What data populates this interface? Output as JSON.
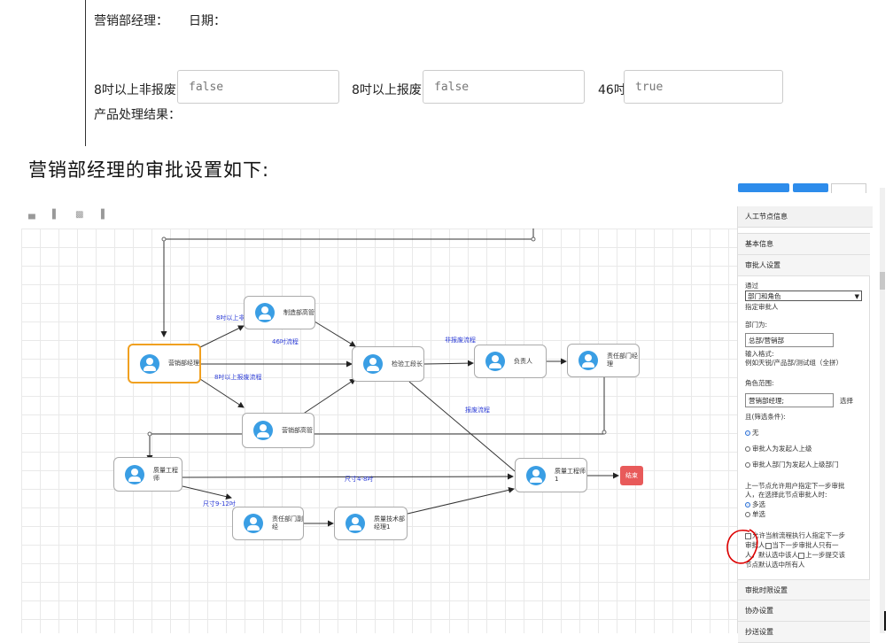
{
  "form": {
    "line1": "营销部经理：",
    "date_label": "日期：",
    "field1_label": "8吋以上非报废",
    "field1_value": "false",
    "field2_label": "8吋以上报废",
    "field2_value": "false",
    "field3_label": "46吋",
    "field3_value": "true",
    "result_label": "产品处理结果："
  },
  "section_title": "营销部经理的审批设置如下:",
  "workflow": {
    "nodes": {
      "sales_manager": "营销部经理",
      "mfg_director": "制造部高管",
      "inspection_lead": "检验工段长",
      "responsible": "负责人",
      "resp_dept_mgr": "责任部门经理",
      "sales_director": "营销部高管",
      "qa_engineer": "质量工程师",
      "qa_engineer1": "质量工程师1",
      "end": "结束",
      "resp_dept_lead": "责任部门副经",
      "qa_tech_mgr": "质量技术部经理1"
    },
    "edges": {
      "e1": "8吋以上非报废流程",
      "e2": "46吋流程",
      "e3": "8吋以上报废流程",
      "e4": "非报废流程",
      "e5": "报废流程",
      "e6": "尺寸4-8吋",
      "e7": "尺寸9-12吋"
    }
  },
  "panel": {
    "title": "人工节点信息",
    "basic_info": "基本信息",
    "approver_settings": "审批人设置",
    "via_label": "通过",
    "via_select": "部门和角色",
    "assign_label": "指定审批人",
    "dept_label": "部门为:",
    "dept_value": "总部/营销部",
    "format_label": "输入格式:",
    "format_example": "例如天锐/产品部/测试组（全拼）",
    "role_label": "角色范围:",
    "role_value": "营销部经理;",
    "role_choose": "选择",
    "filter_label": "且(筛选条件):",
    "radio_none": "无",
    "radio_initiator_superior": "审批人为发起人上级",
    "radio_dept_superior": "审批人部门为发起人上级部门",
    "prev_node_line1": "上一节点允许用户指定下一步审批",
    "prev_node_line2": "人，在选择此节点审批人时:",
    "multi_select": "多选",
    "single_select": "单选",
    "allow_line1": "允许当前流程执行人指定下一步",
    "allow_line2a": "审批人",
    "allow_line2b": "当下一步审批人只有一",
    "allow_line3a": "人，默认选中该人",
    "allow_line3b": "上一步提交该",
    "allow_line4": "节点默认选中所有人",
    "time_limit": "审批时限设置",
    "assist": "协办设置",
    "cc": "抄送设置"
  },
  "colors": {
    "accent": "#2d8ceb",
    "node_active": "#f0a020",
    "end_node": "#e85a5a",
    "edge_label": "#2b3bd6",
    "annotation": "#dd0000"
  }
}
